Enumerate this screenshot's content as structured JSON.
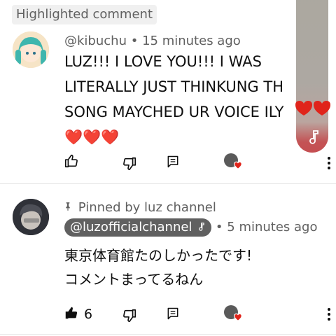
{
  "highlight_badge": "Highlighted comment",
  "comments": [
    {
      "author": "@kibuchu",
      "time": "15 minutes ago",
      "lines": [
        "LUZ!!! I LOVE YOU!!! I WAS",
        "LITERALLY JUST THINKUNG TH",
        "SONG MAYCHED UR VOICE ILY ",
        ""
      ],
      "hearts": "❤️❤️❤️",
      "like_count": "",
      "liked": false
    },
    {
      "pinned_label": "Pinned by luz channel",
      "author": "@luzofficialchannel",
      "time": "5 minutes ago",
      "lines": [
        "東京体育館たのしかったです!",
        "コメントまってるねん"
      ],
      "like_count": "6",
      "liked": true
    }
  ],
  "separator": "•",
  "colors": {
    "heart": "#e0241b",
    "chip_bg": "#606060",
    "meta": "#606060"
  },
  "icons": [
    "like-icon",
    "dislike-icon",
    "reply-icon",
    "creator-heart-icon",
    "more-icon",
    "pin-icon",
    "music-note-icon"
  ]
}
